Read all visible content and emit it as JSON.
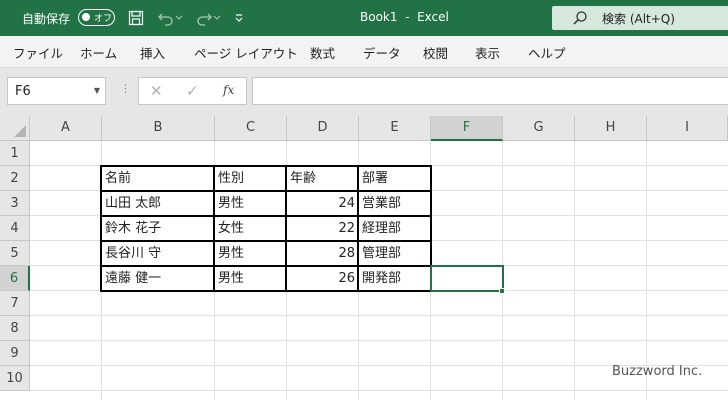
{
  "titlebar": {
    "autosave_label": "自動保存",
    "autosave_toggle": "オフ",
    "title": "Book1  -  Excel",
    "search_placeholder": "検索 (Alt+Q)"
  },
  "menu": [
    "ファイル",
    "ホーム",
    "挿入",
    "ページ レイアウト",
    "数式",
    "データ",
    "校閲",
    "表示",
    "ヘルプ"
  ],
  "formula_bar": {
    "name_box": "F6",
    "cancel_glyph": "✕",
    "enter_glyph": "✓",
    "fx_label": "fx",
    "formula": ""
  },
  "columns": [
    "A",
    "B",
    "C",
    "D",
    "E",
    "F",
    "G",
    "H",
    "I"
  ],
  "rows": [
    "1",
    "2",
    "3",
    "4",
    "5",
    "6",
    "7",
    "8",
    "9",
    "10"
  ],
  "selected": {
    "column": "F",
    "row": "6"
  },
  "table": {
    "header": [
      "名前",
      "性別",
      "年齢",
      "部署"
    ],
    "rows": [
      [
        "山田 太郎",
        "男性",
        "24",
        "営業部"
      ],
      [
        "鈴木 花子",
        "女性",
        "22",
        "経理部"
      ],
      [
        "長谷川 守",
        "男性",
        "28",
        "管理部"
      ],
      [
        "遠藤 健一",
        "男性",
        "26",
        "開発部"
      ]
    ]
  },
  "watermark": "Buzzword Inc.",
  "colors": {
    "accent": "#217346",
    "header_bg": "#e6e6e6",
    "gridline": "#e1e1e1"
  }
}
